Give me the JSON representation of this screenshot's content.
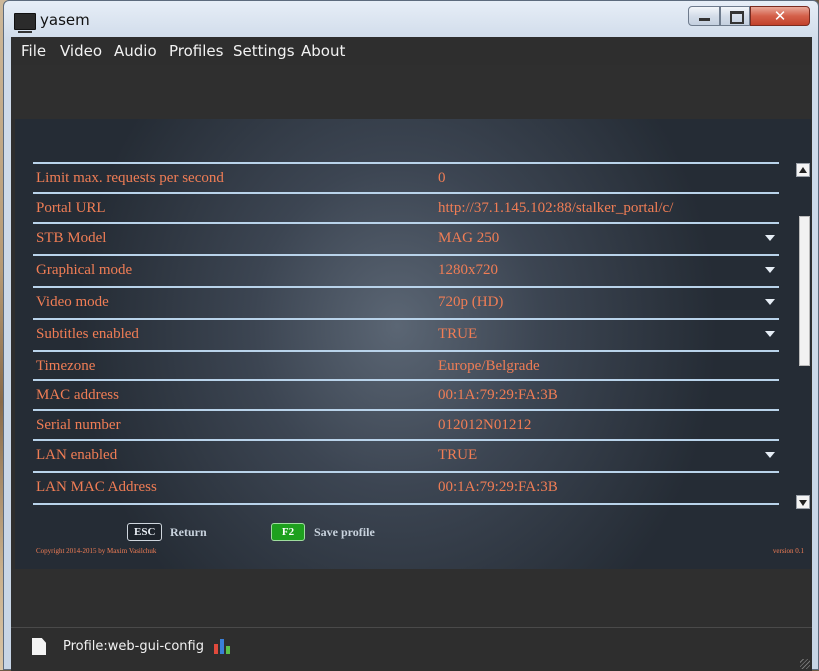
{
  "window": {
    "title": "yasem",
    "controls": {
      "minimize": "minimize",
      "maximize": "maximize",
      "close": "✕"
    }
  },
  "menu": [
    "File",
    "Video",
    "Audio",
    "Profiles",
    "Settings",
    "About"
  ],
  "settings": {
    "rows": [
      {
        "label": "Limit max. requests per second",
        "value": "0",
        "dropdown": false
      },
      {
        "label": "Portal URL",
        "value": "http://37.1.145.102:88/stalker_portal/c/",
        "dropdown": false
      },
      {
        "label": "STB Model",
        "value": "MAG 250",
        "dropdown": true
      },
      {
        "label": "Graphical mode",
        "value": "1280x720",
        "dropdown": true
      },
      {
        "label": "Video mode",
        "value": "720p (HD)",
        "dropdown": true
      },
      {
        "label": "Subtitles enabled",
        "value": "TRUE",
        "dropdown": true
      },
      {
        "label": "Timezone",
        "value": "Europe/Belgrade",
        "dropdown": false
      },
      {
        "label": "MAC address",
        "value": "00:1A:79:29:FA:3B",
        "dropdown": false
      },
      {
        "label": "Serial number",
        "value": "012012N01212",
        "dropdown": false
      },
      {
        "label": "LAN enabled",
        "value": "TRUE",
        "dropdown": true
      },
      {
        "label": "LAN MAC Address",
        "value": "00:1A:79:29:FA:3B",
        "dropdown": false
      }
    ]
  },
  "hotkeys": {
    "esc_key": "ESC",
    "esc_label": "Return",
    "f2_key": "F2",
    "f2_label": "Save profile"
  },
  "footer": {
    "copyright": "Copyright 2014-2015 by Maxim Vasilchuk",
    "version": "version 0.1"
  },
  "statusbar": {
    "profile": "Profile:web-gui-config"
  },
  "colors": {
    "label_text": "#f07d55",
    "row_divider": "#b9d3ea",
    "f2_key_bg": "#1ea01e"
  }
}
